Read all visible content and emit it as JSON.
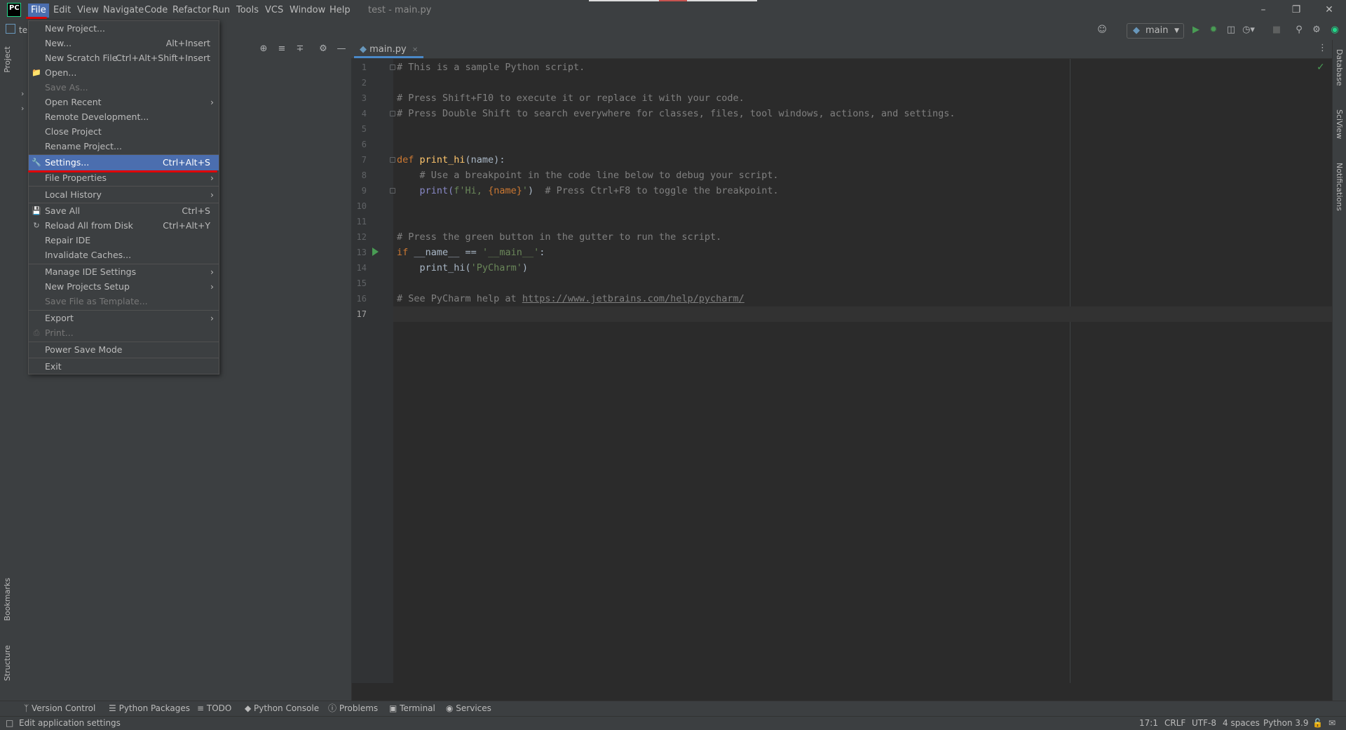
{
  "menubar": {
    "logo": "PC",
    "items": [
      "File",
      "Edit",
      "View",
      "Navigate",
      "Code",
      "Refactor",
      "Run",
      "Tools",
      "VCS",
      "Window",
      "Help"
    ],
    "window_title": "test - main.py"
  },
  "toolbar": {
    "project_label": "te",
    "run_config": "main"
  },
  "left_strip": {
    "project": "Project",
    "bookmarks": "Bookmarks",
    "structure": "Structure"
  },
  "right_strip": {
    "database": "Database",
    "sciview": "SciView",
    "notifications": "Notifications"
  },
  "editor": {
    "tab": "main.py",
    "line_numbers": [
      "1",
      "2",
      "3",
      "4",
      "5",
      "6",
      "7",
      "8",
      "9",
      "10",
      "11",
      "12",
      "13",
      "14",
      "15",
      "16",
      "17"
    ],
    "lines": {
      "l1": "# This is a sample Python script.",
      "l3": "# Press Shift+F10 to execute it or replace it with your code.",
      "l4": "# Press Double Shift to search everywhere for classes, files, tool windows, actions, and settings.",
      "l7_kw": "def ",
      "l7_fn": "print_hi",
      "l7_rest": "(name):",
      "l8": "    # Use a breakpoint in the code line below to debug your script.",
      "l9_a": "    print(",
      "l9_str1": "f'Hi, ",
      "l9_var": "{name}",
      "l9_str2": "'",
      "l9_b": ")  ",
      "l9_cmt": "# Press Ctrl+F8 to toggle the breakpoint.",
      "l12": "# Press the green button in the gutter to run the script.",
      "l13_kw": "if ",
      "l13_a": "__name__ == ",
      "l13_str": "'__main__'",
      "l13_b": ":",
      "l14_a": "    print_hi(",
      "l14_str": "'PyCharm'",
      "l14_b": ")",
      "l16_a": "# See PyCharm help at ",
      "l16_link": "https://www.jetbrains.com/help/pycharm/"
    }
  },
  "file_menu": {
    "items": [
      {
        "label": "New Project...",
        "shortcut": ""
      },
      {
        "label": "New...",
        "shortcut": "Alt+Insert"
      },
      {
        "label": "New Scratch File",
        "shortcut": "Ctrl+Alt+Shift+Insert"
      },
      {
        "label": "Open...",
        "shortcut": ""
      },
      {
        "label": "Save As...",
        "shortcut": ""
      },
      {
        "label": "Open Recent",
        "shortcut": ""
      },
      {
        "label": "Remote Development...",
        "shortcut": ""
      },
      {
        "label": "Close Project",
        "shortcut": ""
      },
      {
        "label": "Rename Project...",
        "shortcut": ""
      },
      {
        "label": "Settings...",
        "shortcut": "Ctrl+Alt+S"
      },
      {
        "label": "File Properties",
        "shortcut": ""
      },
      {
        "label": "Local History",
        "shortcut": ""
      },
      {
        "label": "Save All",
        "shortcut": "Ctrl+S"
      },
      {
        "label": "Reload All from Disk",
        "shortcut": "Ctrl+Alt+Y"
      },
      {
        "label": "Repair IDE",
        "shortcut": ""
      },
      {
        "label": "Invalidate Caches...",
        "shortcut": ""
      },
      {
        "label": "Manage IDE Settings",
        "shortcut": ""
      },
      {
        "label": "New Projects Setup",
        "shortcut": ""
      },
      {
        "label": "Save File as Template...",
        "shortcut": ""
      },
      {
        "label": "Export",
        "shortcut": ""
      },
      {
        "label": "Print...",
        "shortcut": ""
      },
      {
        "label": "Power Save Mode",
        "shortcut": ""
      },
      {
        "label": "Exit",
        "shortcut": ""
      }
    ]
  },
  "bottom_tools": [
    "Version Control",
    "Python Packages",
    "TODO",
    "Python Console",
    "Problems",
    "Terminal",
    "Services"
  ],
  "status": {
    "message": "Edit application settings",
    "position": "17:1",
    "line_sep": "CRLF",
    "encoding": "UTF-8",
    "indent": "4 spaces",
    "interpreter": "Python 3.9"
  },
  "colors": {
    "accent": "#4b6eaf",
    "tab_underline": "#4a88c7",
    "run_green": "#499c54",
    "annotation_red": "#e00000"
  }
}
